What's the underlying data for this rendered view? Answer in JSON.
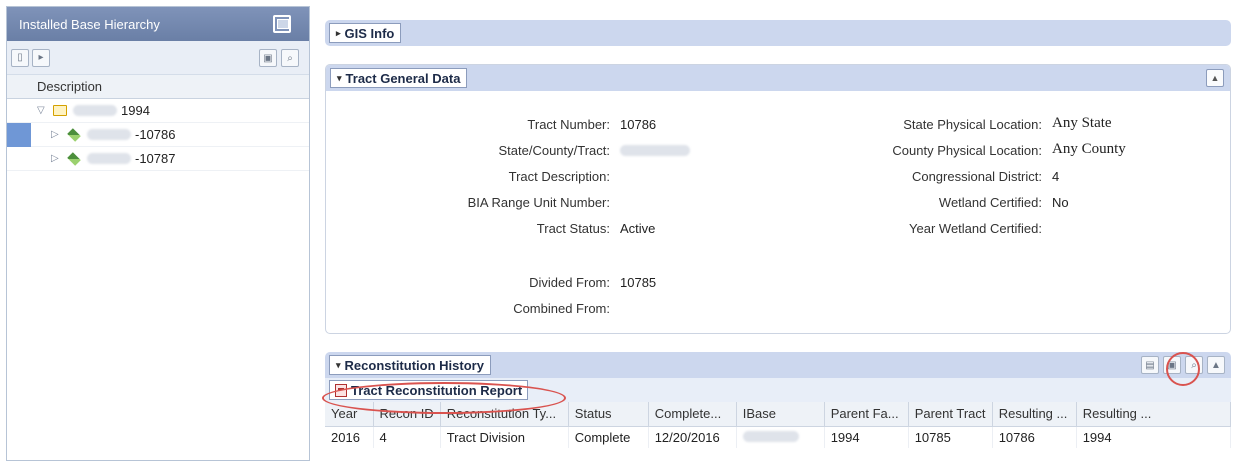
{
  "hierarchy": {
    "title": "Installed Base Hierarchy",
    "column_header": "Description",
    "items": [
      {
        "label": "1994",
        "level": 0
      },
      {
        "label": "-10786",
        "level": 1
      },
      {
        "label": "-10787",
        "level": 1
      }
    ]
  },
  "gis": {
    "label": "GIS Info"
  },
  "general": {
    "title": "Tract General Data",
    "left_fields": [
      {
        "label": "Tract Number:",
        "value": "10786"
      },
      {
        "label": "State/County/Tract:",
        "value": ""
      },
      {
        "label": "Tract Description:",
        "value": ""
      },
      {
        "label": "BIA Range Unit Number:",
        "value": ""
      },
      {
        "label": "Tract Status:",
        "value": "Active"
      },
      {
        "label": "Divided From:",
        "value": "10785"
      },
      {
        "label": "Combined From:",
        "value": ""
      }
    ],
    "right_fields": [
      {
        "label": "State Physical Location:",
        "value": "Any State"
      },
      {
        "label": "County Physical Location:",
        "value": "Any County"
      },
      {
        "label": "Congressional District:",
        "value": "4"
      },
      {
        "label": "Wetland Certified:",
        "value": "No"
      },
      {
        "label": "Year Wetland Certified:",
        "value": ""
      }
    ]
  },
  "recon": {
    "title": "Reconstitution History",
    "report_link": "Tract Reconstitution Report",
    "columns": [
      "Year",
      "Recon ID",
      "Reconstitution Ty...",
      "Status",
      "Complete...",
      "IBase",
      "Parent Fa...",
      "Parent Tract",
      "Resulting ...",
      "Resulting ..."
    ],
    "rows": [
      [
        "2016",
        "4",
        "Tract Division",
        "Complete",
        "12/20/2016",
        "",
        "1994",
        "10785",
        "10786",
        "1994"
      ]
    ]
  }
}
